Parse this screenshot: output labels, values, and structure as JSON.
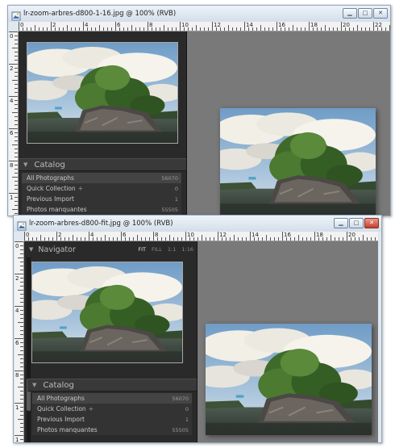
{
  "window1": {
    "title": "lr-zoom-arbres-d800-1-16.jpg @ 100% (RVB)",
    "ruler_h": [
      "0",
      "2",
      "4",
      "6",
      "8",
      "10",
      "12",
      "14",
      "16",
      "18",
      "20",
      "22"
    ],
    "ruler_v": [
      "0",
      "2",
      "4",
      "6",
      "8",
      "1",
      "1"
    ],
    "section_title": "Catalog",
    "catalog": [
      {
        "name": "All Photographs",
        "count": "56070",
        "selected": true
      },
      {
        "name": "Quick Collection",
        "plus": "+",
        "count": "0",
        "selected": false
      },
      {
        "name": "Previous Import",
        "count": "1",
        "selected": false
      },
      {
        "name": "Photos manquantes",
        "count": "55505",
        "selected": false
      }
    ]
  },
  "window2": {
    "title": "lr-zoom-arbres-d800-fit.jpg @ 100% (RVB)",
    "ruler_h": [
      "0",
      "2",
      "4",
      "6",
      "8",
      "10",
      "12",
      "14",
      "16",
      "18",
      "20",
      "22"
    ],
    "ruler_v": [
      "0",
      "2",
      "4",
      "6",
      "8",
      "1",
      "1"
    ],
    "navigator_title": "Navigator",
    "nav_modes": [
      {
        "label": "FIT",
        "active": true
      },
      {
        "label": "FILL",
        "active": false
      },
      {
        "label": "1:1",
        "active": false
      },
      {
        "label": "1:16",
        "active": false
      }
    ],
    "section_title": "Catalog",
    "catalog": [
      {
        "name": "All Photographs",
        "count": "56070",
        "selected": true
      },
      {
        "name": "Quick Collection",
        "plus": "+",
        "count": "0",
        "selected": false
      },
      {
        "name": "Previous Import",
        "count": "1",
        "selected": false
      },
      {
        "name": "Photos manquantes",
        "count": "55505",
        "selected": false
      }
    ]
  },
  "icons": {
    "window_icon": "image-file-icon",
    "minimize": "minimize-icon",
    "maximize": "maximize-icon",
    "close": "close-icon",
    "disclosure": "triangle-down-icon"
  },
  "glyphs": {
    "minimize": "▁",
    "maximize": "□",
    "close": "✕",
    "tri_down": "▼"
  },
  "colors": {
    "window_frame": "#dfe8f1",
    "panel_bg": "#2a2a2a",
    "canvas_bg": "#797979",
    "close_red": "#c0402c"
  }
}
